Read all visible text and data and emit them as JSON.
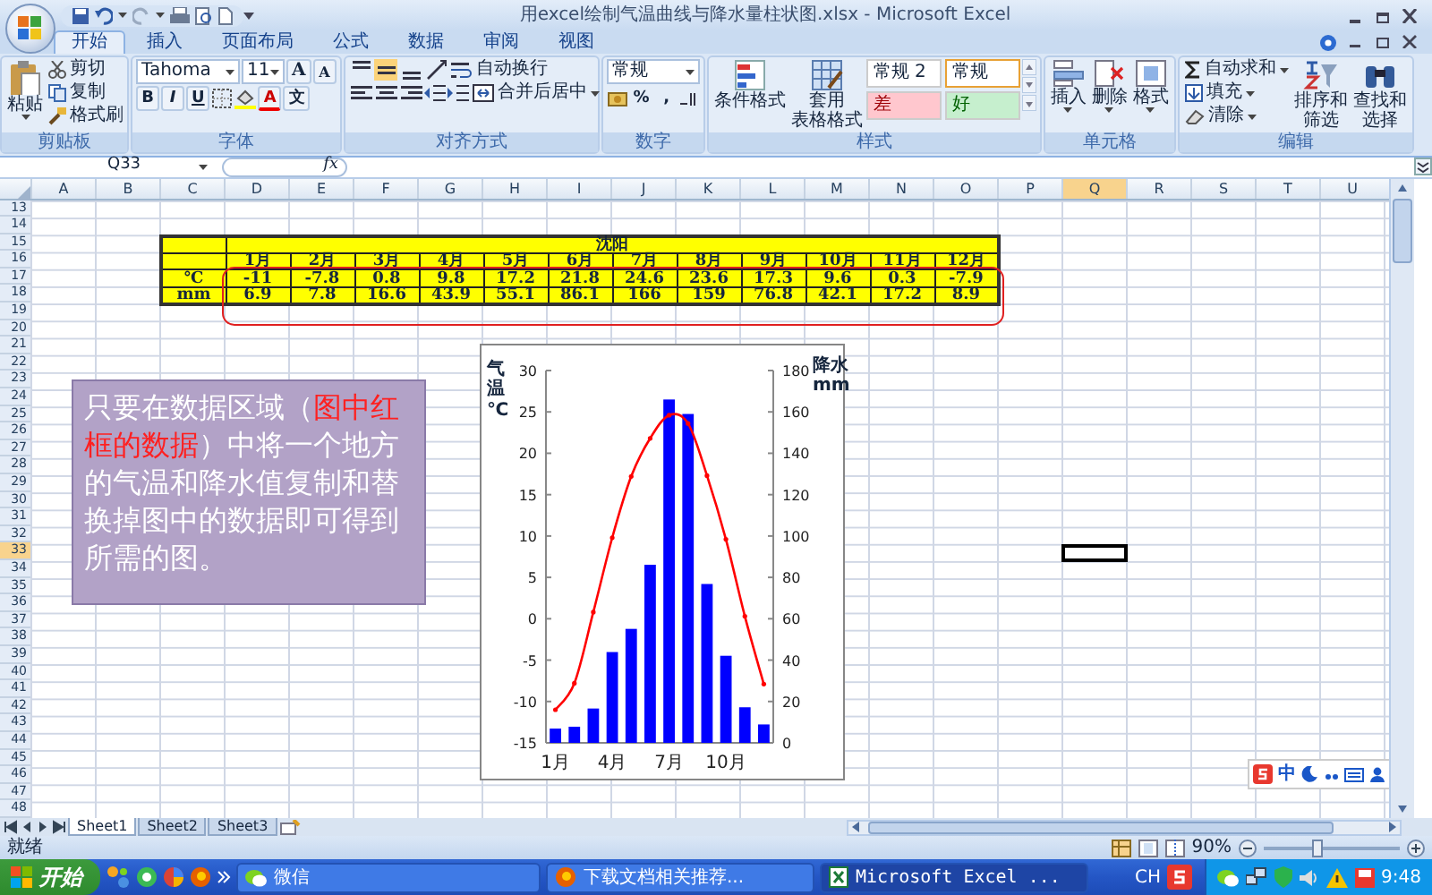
{
  "window": {
    "title": "用excel绘制气温曲线与降水量柱状图.xlsx - Microsoft Excel"
  },
  "tabs": [
    {
      "label": "开始",
      "selected": true
    },
    {
      "label": "插入",
      "selected": false
    },
    {
      "label": "页面布局",
      "selected": false
    },
    {
      "label": "公式",
      "selected": false
    },
    {
      "label": "数据",
      "selected": false
    },
    {
      "label": "审阅",
      "selected": false
    },
    {
      "label": "视图",
      "selected": false
    }
  ],
  "ribbon": {
    "clipboard": {
      "title": "剪贴板",
      "paste": "粘贴",
      "actions": [
        "剪切",
        "复制",
        "格式刷"
      ]
    },
    "font": {
      "title": "字体",
      "family": "Tahoma",
      "size": "11",
      "size_buttons": [
        "A",
        "A"
      ],
      "styles": [
        "B",
        "I",
        "U"
      ],
      "color_letter": "A",
      "phonetic": "文"
    },
    "alignment": {
      "title": "对齐方式",
      "wrap": "自动换行",
      "merge": "合并后居中"
    },
    "number": {
      "title": "数字",
      "format": "常规",
      "symbols": [
        "%",
        ","
      ]
    },
    "styles": {
      "title": "样式",
      "conditional": [
        "条件格式"
      ],
      "table": [
        "套用",
        "表格格式"
      ],
      "cell_styles": [
        {
          "label": "常规 2",
          "kind": "normal",
          "selected": false
        },
        {
          "label": "常规",
          "kind": "normal",
          "selected": true
        },
        {
          "label": "差",
          "kind": "bad",
          "selected": false
        },
        {
          "label": "好",
          "kind": "good",
          "selected": false
        }
      ]
    },
    "cells": {
      "title": "单元格",
      "buttons": [
        "插入",
        "删除",
        "格式"
      ]
    },
    "editing": {
      "title": "编辑",
      "small": [
        "自动求和",
        "填充",
        "清除"
      ],
      "big": [
        [
          "排序和",
          "筛选"
        ],
        [
          "查找和",
          "选择"
        ]
      ]
    }
  },
  "formula_bar": {
    "name_box": "Q33",
    "function_label": "fx"
  },
  "columns": [
    {
      "label": "A",
      "selected": false
    },
    {
      "label": "B",
      "selected": false
    },
    {
      "label": "C",
      "selected": false
    },
    {
      "label": "D",
      "selected": false
    },
    {
      "label": "E",
      "selected": false
    },
    {
      "label": "F",
      "selected": false
    },
    {
      "label": "G",
      "selected": false
    },
    {
      "label": "H",
      "selected": false
    },
    {
      "label": "I",
      "selected": false
    },
    {
      "label": "J",
      "selected": false
    },
    {
      "label": "K",
      "selected": false
    },
    {
      "label": "L",
      "selected": false
    },
    {
      "label": "M",
      "selected": false
    },
    {
      "label": "N",
      "selected": false
    },
    {
      "label": "O",
      "selected": false
    },
    {
      "label": "P",
      "selected": false
    },
    {
      "label": "Q",
      "selected": true
    },
    {
      "label": "R",
      "selected": false
    },
    {
      "label": "S",
      "selected": false
    },
    {
      "label": "T",
      "selected": false
    },
    {
      "label": "U",
      "selected": false
    }
  ],
  "rows": [
    {
      "label": "13",
      "selected": false
    },
    {
      "label": "14",
      "selected": false
    },
    {
      "label": "15",
      "selected": false
    },
    {
      "label": "16",
      "selected": false
    },
    {
      "label": "17",
      "selected": false
    },
    {
      "label": "18",
      "selected": false
    },
    {
      "label": "19",
      "selected": false
    },
    {
      "label": "20",
      "selected": false
    },
    {
      "label": "21",
      "selected": false
    },
    {
      "label": "22",
      "selected": false
    },
    {
      "label": "23",
      "selected": false
    },
    {
      "label": "24",
      "selected": false
    },
    {
      "label": "25",
      "selected": false
    },
    {
      "label": "26",
      "selected": false
    },
    {
      "label": "27",
      "selected": false
    },
    {
      "label": "28",
      "selected": false
    },
    {
      "label": "29",
      "selected": false
    },
    {
      "label": "30",
      "selected": false
    },
    {
      "label": "31",
      "selected": false
    },
    {
      "label": "32",
      "selected": false
    },
    {
      "label": "33",
      "selected": true
    },
    {
      "label": "34",
      "selected": false
    },
    {
      "label": "35",
      "selected": false
    },
    {
      "label": "36",
      "selected": false
    },
    {
      "label": "37",
      "selected": false
    },
    {
      "label": "38",
      "selected": false
    },
    {
      "label": "39",
      "selected": false
    },
    {
      "label": "40",
      "selected": false
    },
    {
      "label": "41",
      "selected": false
    },
    {
      "label": "42",
      "selected": false
    },
    {
      "label": "43",
      "selected": false
    },
    {
      "label": "44",
      "selected": false
    },
    {
      "label": "45",
      "selected": false
    },
    {
      "label": "46",
      "selected": false
    },
    {
      "label": "47",
      "selected": false
    },
    {
      "label": "48",
      "selected": false
    }
  ],
  "data_table": {
    "title": "沈阳",
    "months": [
      "1月",
      "2月",
      "3月",
      "4月",
      "5月",
      "6月",
      "7月",
      "8月",
      "9月",
      "10月",
      "11月",
      "12月"
    ],
    "rows": [
      {
        "unit": "℃",
        "values": [
          "-11",
          "-7.8",
          "0.8",
          "9.8",
          "17.2",
          "21.8",
          "24.6",
          "23.6",
          "17.3",
          "9.6",
          "0.3",
          "-7.9"
        ]
      },
      {
        "unit": "mm",
        "values": [
          "6.9",
          "7.8",
          "16.6",
          "43.9",
          "55.1",
          "86.1",
          "166",
          "159",
          "76.8",
          "42.1",
          "17.2",
          "8.9"
        ]
      }
    ]
  },
  "note_box": {
    "segments": [
      {
        "text": "只要在数据区域（",
        "highlight": false
      },
      {
        "text": "图中红框的数据",
        "highlight": true
      },
      {
        "text": "）中将一个地方的气温和降水值复制和替换掉图中的数据即可得到所需的图。",
        "highlight": false
      }
    ]
  },
  "chart": {
    "chart_data": {
      "type": "bar",
      "x": [
        1,
        2,
        3,
        4,
        5,
        6,
        7,
        8,
        9,
        10,
        11,
        12
      ],
      "xlim": [
        0.5,
        12.5
      ],
      "xticks": [
        {
          "value": 1,
          "label": "1月"
        },
        {
          "value": 4,
          "label": "4月"
        },
        {
          "value": 7,
          "label": "7月"
        },
        {
          "value": 10,
          "label": "10月"
        }
      ],
      "ylabel": "气温℃",
      "ylim": [
        -15,
        30
      ],
      "yticks": [
        -15,
        -10,
        -5,
        0,
        5,
        10,
        15,
        20,
        25,
        30
      ],
      "y2label": "降水mm",
      "y2lim": [
        0,
        180
      ],
      "y2ticks": [
        0,
        20,
        40,
        60,
        80,
        100,
        120,
        140,
        160,
        180
      ],
      "series": [
        {
          "axis": "y2",
          "color": "#0000ff",
          "values": [
            6.9,
            7.8,
            16.6,
            43.9,
            55.1,
            86.1,
            166,
            159,
            76.8,
            42.1,
            17.2,
            8.9
          ]
        },
        {
          "type": "line",
          "color": "#ff0000",
          "values": [
            -11,
            -7.8,
            0.8,
            9.8,
            17.2,
            21.8,
            24.6,
            23.6,
            17.3,
            9.6,
            0.3,
            -7.9
          ]
        }
      ]
    }
  },
  "ime_bar": {
    "label": "中"
  },
  "sheet_tabs": [
    {
      "label": "Sheet1",
      "selected": true
    },
    {
      "label": "Sheet2",
      "selected": false
    },
    {
      "label": "Sheet3",
      "selected": false
    }
  ],
  "status_bar": {
    "text": "就绪",
    "zoom": "90%",
    "zoom_slider": {
      "level": 0.4
    }
  },
  "taskbar": {
    "start": "开始",
    "windows": [
      {
        "label": "微信",
        "selected": false
      },
      {
        "label": "下载文档相关推荐...",
        "selected": false
      },
      {
        "label": "Microsoft Excel ...",
        "selected": true
      }
    ],
    "language": "CH",
    "clock": "9:48"
  }
}
